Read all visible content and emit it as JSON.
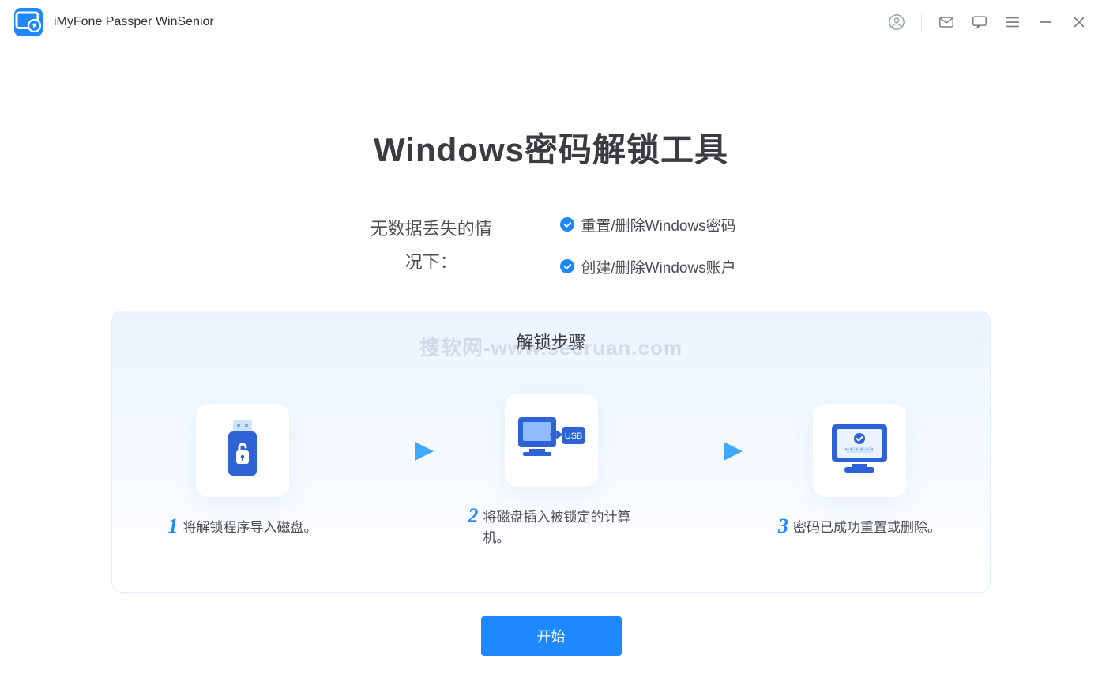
{
  "titlebar": {
    "app_name": "iMyFone Passper WinSenior"
  },
  "main": {
    "headline": "Windows密码解锁工具",
    "subhead": "无数据丢失的情况下：",
    "features": [
      "重置/删除Windows密码",
      "创建/删除Windows账户"
    ]
  },
  "steps": {
    "title": "解锁步骤",
    "watermark": "搜软网-www.secruan.com",
    "items": [
      {
        "num": "1",
        "text": "将解锁程序导入磁盘。"
      },
      {
        "num": "2",
        "text": "将磁盘插入被锁定的计算机。"
      },
      {
        "num": "3",
        "text": "密码已成功重置或删除。"
      }
    ]
  },
  "actions": {
    "start": "开始"
  }
}
